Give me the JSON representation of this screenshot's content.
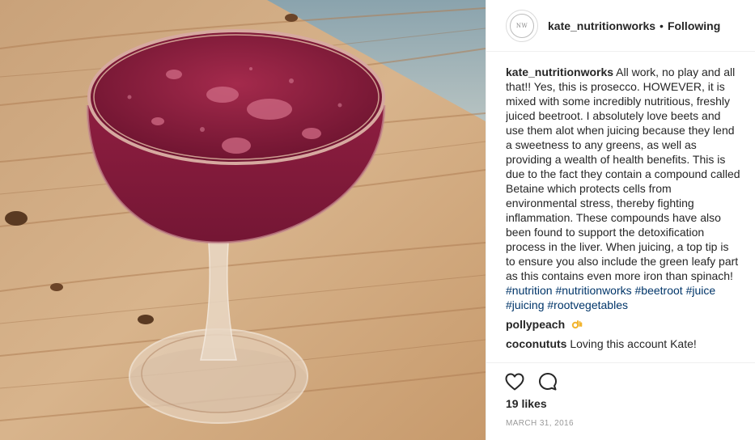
{
  "post": {
    "photo_alt": "icon-name:photo-cocktail",
    "header": {
      "username": "kate_nutritionworks",
      "separator": "•",
      "follow_label": "Following",
      "avatar_text": "NW"
    },
    "caption": {
      "username": "kate_nutritionworks",
      "text": "All work, no play and all that!! Yes, this is prosecco. HOWEVER, it is mixed with some incredibly nutritious, freshly juiced beetroot. I absolutely love beets and use them alot when juicing because they lend a sweetness to any greens, as well as providing a wealth of health benefits. This is due to the fact they contain a compound called Betaine which protects cells from environmental stress, thereby fighting inflammation. These compounds have also been found to support the detoxification process in the liver. When juicing, a top tip is to ensure you also include the green leafy part as this contains even more iron than spinach!",
      "hashtags": "#nutrition #nutritionworks #beetroot #juice #juicing #rootvegetables"
    },
    "comments": [
      {
        "username": "pollypeach",
        "text": "",
        "emoji": "ok-hand-emoji"
      },
      {
        "username": "coconututs",
        "text": "Loving this account Kate!"
      }
    ],
    "likes": "19 likes",
    "date": "MARCH 31, 2016",
    "icons": {
      "like": "heart-icon",
      "comment": "comment-icon"
    },
    "colors": {
      "hashtag": "#003569",
      "border": "#efefef",
      "drink": "#8a1e3c"
    }
  }
}
